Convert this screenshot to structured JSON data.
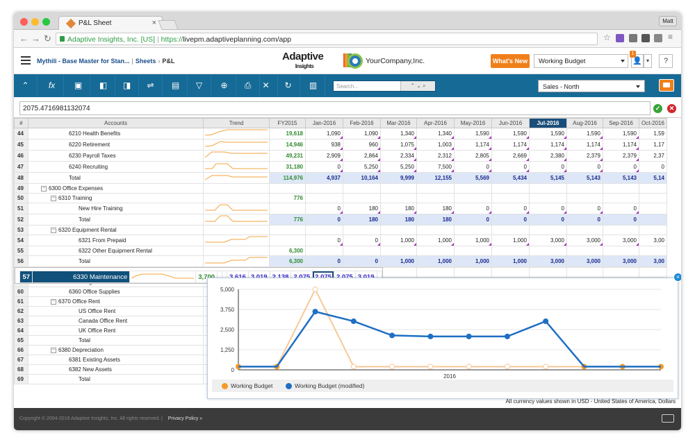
{
  "browser": {
    "tab_title": "P&L Sheet",
    "user_label": "Matt",
    "org_label": "Adaptive Insights, Inc. [US]",
    "url_scheme": "https://",
    "url_rest": "livepm.adaptiveplanning.com/app"
  },
  "header": {
    "breadcrumb_instance": "Mythili - Base Master for Stan...",
    "breadcrumb_sheets": "Sheets",
    "breadcrumb_current": "P&L",
    "logo_line1": "Adaptive",
    "logo_line2": "Insights",
    "company_name": "YourCompany,Inc.",
    "whats_new": "What's New",
    "version": "Working Budget",
    "notification_count": "1",
    "help": "?"
  },
  "toolbar": {
    "search_placeholder": "Search...",
    "level": "Sales - North"
  },
  "formula": {
    "value": "2075.4716981132074"
  },
  "grid": {
    "columns": [
      "#",
      "Accounts",
      "Trend",
      "FY2015",
      "Jan-2016",
      "Feb-2016",
      "Mar-2016",
      "Apr-2016",
      "May-2016",
      "Jun-2016",
      "Jul-2016",
      "Aug-2016",
      "Sep-2016",
      "Oct-2016"
    ],
    "rows": [
      {
        "n": "44",
        "acc": "6210 Health Benefits",
        "lvl": 2,
        "fy": "19,618",
        "v": [
          "1,090",
          "1,090",
          "1,340",
          "1,340",
          "1,590",
          "1,590",
          "1,590",
          "1,590",
          "1,590",
          "1,59"
        ]
      },
      {
        "n": "45",
        "acc": "6220 Retirement",
        "lvl": 2,
        "fy": "14,946",
        "v": [
          "938",
          "960",
          "1,075",
          "1,003",
          "1,174",
          "1,174",
          "1,174",
          "1,174",
          "1,174",
          "1,17"
        ]
      },
      {
        "n": "46",
        "acc": "6230 Payroll Taxes",
        "lvl": 2,
        "fy": "49,231",
        "v": [
          "2,909",
          "2,864",
          "2,334",
          "2,312",
          "2,805",
          "2,669",
          "2,380",
          "2,379",
          "2,379",
          "2,37"
        ]
      },
      {
        "n": "47",
        "acc": "6240 Recruiting",
        "lvl": 2,
        "fy": "31,180",
        "v": [
          "0",
          "5,250",
          "5,250",
          "7,500",
          "0",
          "0",
          "0",
          "0",
          "0",
          "0"
        ]
      },
      {
        "n": "48",
        "acc": "Total",
        "lvl": 2,
        "fy": "114,976",
        "tot": true,
        "v": [
          "4,937",
          "10,164",
          "9,999",
          "12,155",
          "5,569",
          "5,434",
          "5,145",
          "5,143",
          "5,143",
          "5,14"
        ]
      },
      {
        "n": "49",
        "acc": "6300 Office Expenses",
        "lvl": 0,
        "ex": true,
        "fy": "",
        "grp": true,
        "v": [
          "",
          "",
          "",
          "",
          "",
          "",
          "",
          "",
          "",
          ""
        ]
      },
      {
        "n": "50",
        "acc": "6310 Training",
        "lvl": 1,
        "ex": true,
        "fy": "776",
        "grp": true,
        "v": [
          "",
          "",
          "",
          "",
          "",
          "",
          "",
          "",
          "",
          ""
        ]
      },
      {
        "n": "51",
        "acc": "New Hire Training",
        "lvl": 3,
        "fy": "",
        "v": [
          "0",
          "180",
          "180",
          "180",
          "0",
          "0",
          "0",
          "0",
          "0",
          ""
        ]
      },
      {
        "n": "52",
        "acc": "Total",
        "lvl": 3,
        "fy": "776",
        "tot": true,
        "v": [
          "0",
          "180",
          "180",
          "180",
          "0",
          "0",
          "0",
          "0",
          "0",
          ""
        ]
      },
      {
        "n": "53",
        "acc": "6320 Equipment Rental",
        "lvl": 1,
        "ex": true,
        "fy": "",
        "grp": true,
        "v": [
          "",
          "",
          "",
          "",
          "",
          "",
          "",
          "",
          "",
          ""
        ]
      },
      {
        "n": "54",
        "acc": "6321 From Prepaid",
        "lvl": 3,
        "fy": "",
        "v": [
          "0",
          "0",
          "1,000",
          "1,000",
          "1,000",
          "1,000",
          "3,000",
          "3,000",
          "3,000",
          "3,00"
        ]
      },
      {
        "n": "55",
        "acc": "6322 Other Equipment Rental",
        "lvl": 3,
        "fy": "6,300",
        "v": [
          "",
          "",
          "",
          "",
          "",
          "",
          "",
          "",
          "",
          ""
        ]
      },
      {
        "n": "56",
        "acc": "Total",
        "lvl": 3,
        "fy": "6,300",
        "tot": true,
        "v": [
          "0",
          "0",
          "1,000",
          "1,000",
          "1,000",
          "1,000",
          "3,000",
          "3,000",
          "3,000",
          "3,00"
        ]
      },
      {
        "n": "57",
        "acc": "6330 Maintenance",
        "lvl": 2,
        "fy": "3,700",
        "sel": true,
        "v": [
          "",
          "",
          "3,616",
          "3,019",
          "2,138",
          "2,075",
          "2,075",
          "2,075",
          "3,019",
          ""
        ]
      },
      {
        "n": "58",
        "acc": "6340 Telephone",
        "lvl": 2,
        "fy": "",
        "v": []
      },
      {
        "n": "59",
        "acc": "6350 Legal & Professional",
        "lvl": 2,
        "fy": "",
        "v": []
      },
      {
        "n": "60",
        "acc": "6360 Office Supplies",
        "lvl": 2,
        "fy": "",
        "v": []
      },
      {
        "n": "61",
        "acc": "6370 Office Rent",
        "lvl": 1,
        "ex": true,
        "fy": "",
        "v": []
      },
      {
        "n": "62",
        "acc": "US Office Rent",
        "lvl": 3,
        "fy": "",
        "v": []
      },
      {
        "n": "63",
        "acc": "Canada Office Rent",
        "lvl": 3,
        "fy": "",
        "v": []
      },
      {
        "n": "64",
        "acc": "UK Office Rent",
        "lvl": 3,
        "fy": "",
        "v": []
      },
      {
        "n": "65",
        "acc": "Total",
        "lvl": 3,
        "fy": "",
        "v": []
      },
      {
        "n": "66",
        "acc": "6380 Depreciation",
        "lvl": 1,
        "ex": true,
        "fy": "",
        "v": []
      },
      {
        "n": "67",
        "acc": "6381 Existing Assets",
        "lvl": 2,
        "fy": "",
        "v": []
      },
      {
        "n": "68",
        "acc": "6382 New Assets",
        "lvl": 2,
        "fy": "",
        "v": []
      },
      {
        "n": "69",
        "acc": "Total",
        "lvl": 3,
        "fy": "",
        "v": []
      }
    ]
  },
  "chart_data": {
    "type": "line",
    "x_label": "2016",
    "y_ticks": [
      "5,000",
      "3,750",
      "2,500",
      "1,250",
      "0"
    ],
    "ylim": [
      0,
      5000
    ],
    "series": [
      {
        "name": "Working Budget",
        "color": "#f39a2b",
        "values": [
          200,
          200,
          5000,
          200,
          200,
          200,
          200,
          200,
          200,
          200,
          200,
          200
        ]
      },
      {
        "name": "Working Budget (modified)",
        "color": "#1e6fc2",
        "values": [
          200,
          200,
          3616,
          3019,
          2138,
          2075,
          2075,
          2075,
          3019,
          200,
          200,
          200
        ]
      }
    ]
  },
  "footnote": "All currency values shown in USD - United States of America, Dollars",
  "footer": {
    "copyright": "Copyright © 2004-2016 Adaptive Insights, Inc. All rights reserved.",
    "policy": "Privacy Policy »"
  }
}
